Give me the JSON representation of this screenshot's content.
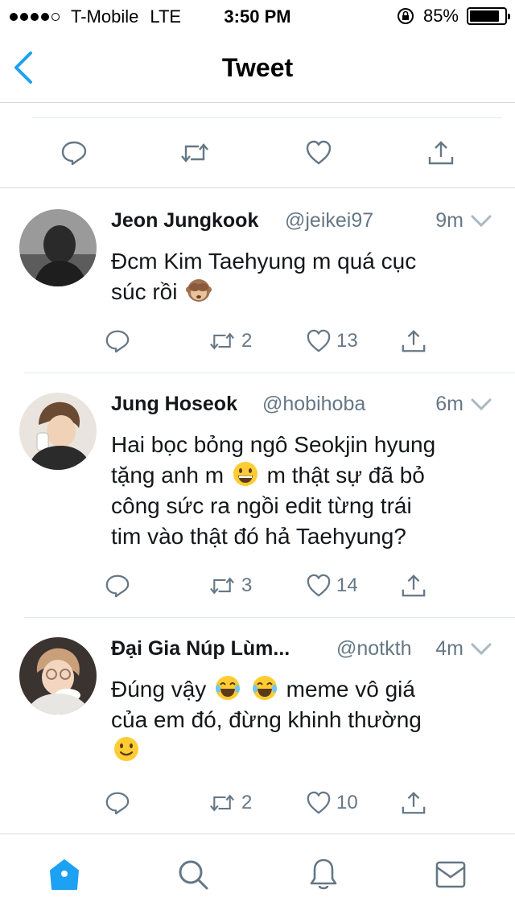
{
  "status_bar": {
    "carrier": "T-Mobile",
    "network": "LTE",
    "time": "3:50 PM",
    "battery_text": "85%",
    "battery_level": 0.85
  },
  "nav": {
    "title": "Tweet",
    "back_icon": "chevron-left-icon"
  },
  "colors": {
    "accent": "#1da1f2",
    "muted": "#657786",
    "icon_gray": "#657786"
  },
  "main_actions": [
    "reply-icon",
    "retweet-icon",
    "like-icon",
    "share-icon"
  ],
  "replies": [
    {
      "name": "Jeon Jungkook",
      "handle": "@jeikei97",
      "time": "9m",
      "text_parts": [
        "Đcm Kim Taehyung m quá cục",
        "súc rồi"
      ],
      "emoji": "see-no-evil-monkey",
      "retweets": "2",
      "likes": "13"
    },
    {
      "name": "Jung Hoseok",
      "handle": "@hobihoba",
      "time": "6m",
      "text_parts": [
        "Hai bọc bỏng ngô Seokjin hyung",
        "tặng anh m",
        "m thật sự đã bỏ",
        "công sức ra ngồi edit từng trái",
        "tim vào thật đó hả Taehyung?"
      ],
      "emoji": "grinning-face",
      "retweets": "3",
      "likes": "14"
    },
    {
      "name": "Đại Gia Núp Lùm...",
      "handle": "@notkth",
      "time": "4m",
      "text_parts": [
        "Đúng vậy",
        "meme vô giá",
        "của em đó, đừng khinh thường"
      ],
      "emoji": "joy-face",
      "emoji_end": "slightly-smiling-face",
      "retweets": "2",
      "likes": "10"
    }
  ],
  "tab_bar": [
    "home-icon",
    "search-icon",
    "notifications-icon",
    "messages-icon"
  ]
}
